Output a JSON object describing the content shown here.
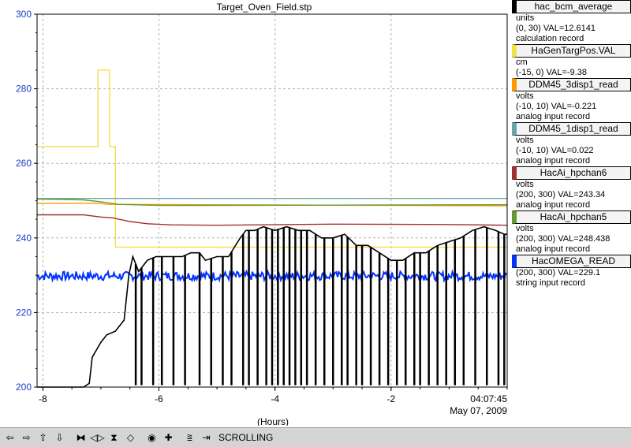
{
  "chart_data": {
    "type": "line",
    "title": "Target_Oven_Field.stp",
    "xlabel": "(Hours)",
    "ylabel": "",
    "xlim": [
      -8.1,
      0
    ],
    "ylim": [
      200,
      300
    ],
    "x_ticks": [
      -8,
      -6,
      -4,
      -2
    ],
    "x_tick_labels": [
      "-8",
      "-6",
      "-4",
      "-2"
    ],
    "y_ticks": [
      200,
      220,
      240,
      260,
      280,
      300
    ],
    "y_tick_labels": [
      "200",
      "220",
      "240",
      "260",
      "280",
      "300"
    ],
    "grid": true,
    "time_label": "04:07:45",
    "date_label": "May 07, 2009",
    "series": [
      {
        "name": "hac_bcm_average",
        "color": "#000000",
        "points": [
          [
            -8.1,
            200
          ],
          [
            -7.3,
            200
          ],
          [
            -7.2,
            201
          ],
          [
            -7.15,
            208
          ],
          [
            -7.0,
            212
          ],
          [
            -6.9,
            214
          ],
          [
            -6.75,
            215
          ],
          [
            -6.6,
            218
          ],
          [
            -6.52,
            230
          ],
          [
            -6.45,
            235
          ],
          [
            -6.35,
            231
          ],
          [
            -6.2,
            234
          ],
          [
            -6.05,
            235
          ],
          [
            -5.8,
            235
          ],
          [
            -5.6,
            235
          ],
          [
            -5.45,
            236
          ],
          [
            -5.3,
            236
          ],
          [
            -5.2,
            234
          ],
          [
            -5.0,
            235
          ],
          [
            -4.8,
            235
          ],
          [
            -4.6,
            240
          ],
          [
            -4.5,
            242
          ],
          [
            -4.35,
            242
          ],
          [
            -4.2,
            243
          ],
          [
            -4.0,
            242
          ],
          [
            -3.8,
            243
          ],
          [
            -3.6,
            242
          ],
          [
            -3.4,
            242
          ],
          [
            -3.2,
            240
          ],
          [
            -3.0,
            240
          ],
          [
            -2.8,
            241
          ],
          [
            -2.6,
            238
          ],
          [
            -2.4,
            238
          ],
          [
            -2.2,
            236
          ],
          [
            -2.0,
            234
          ],
          [
            -1.8,
            234
          ],
          [
            -1.6,
            236
          ],
          [
            -1.4,
            236
          ],
          [
            -1.2,
            238
          ],
          [
            -1.0,
            239
          ],
          [
            -0.8,
            240
          ],
          [
            -0.6,
            242
          ],
          [
            -0.4,
            243
          ],
          [
            -0.2,
            242
          ],
          [
            -0.05,
            241
          ],
          [
            0,
            241
          ]
        ],
        "dropouts": [
          -6.4,
          -6.3,
          -6.1,
          -5.95,
          -5.75,
          -5.55,
          -5.3,
          -5.1,
          -4.9,
          -4.75,
          -4.55,
          -4.45,
          -4.3,
          -4.15,
          -4.05,
          -3.95,
          -3.85,
          -3.75,
          -3.65,
          -3.55,
          -3.45,
          -3.3,
          -3.15,
          -3.0,
          -2.85,
          -2.75,
          -2.6,
          -2.5,
          -2.35,
          -2.2,
          -2.05,
          -1.9,
          -1.75,
          -1.6,
          -1.5,
          -1.35,
          -1.2,
          -1.05,
          -0.9,
          -0.75,
          -0.55,
          -0.35,
          -0.15,
          -0.05
        ]
      },
      {
        "name": "HaGenTargPos.VAL",
        "color": "#f0e04a",
        "points": [
          [
            -8.1,
            264.5
          ],
          [
            -7.05,
            264.5
          ],
          [
            -7.05,
            285
          ],
          [
            -6.85,
            285
          ],
          [
            -6.85,
            264.5
          ],
          [
            -6.75,
            264.5
          ],
          [
            -6.75,
            237.5
          ],
          [
            0,
            237.5
          ]
        ]
      },
      {
        "name": "DDM45_3disp1_read",
        "color": "#ff9900",
        "points": [
          [
            -8.1,
            249.3
          ],
          [
            -7.0,
            249.3
          ],
          [
            -6.9,
            249
          ],
          [
            0,
            248.6
          ]
        ]
      },
      {
        "name": "DDM45_1disp1_read",
        "color": "#66a6a6",
        "points": [
          [
            -8.1,
            250.6
          ],
          [
            0,
            250.6
          ]
        ]
      },
      {
        "name": "HacAi_hpchan6",
        "color": "#a03030",
        "points": [
          [
            -8.1,
            246.2
          ],
          [
            -7.3,
            246.2
          ],
          [
            -7.0,
            245.6
          ],
          [
            -6.8,
            245.4
          ],
          [
            -6.5,
            244.4
          ],
          [
            -6.2,
            243.8
          ],
          [
            -5.8,
            243.5
          ],
          [
            -5.0,
            243.4
          ],
          [
            -3.0,
            243.7
          ],
          [
            -1.0,
            243.6
          ],
          [
            0,
            243.4
          ]
        ]
      },
      {
        "name": "HacAi_hpchan5",
        "color": "#669933",
        "points": [
          [
            -8.1,
            250.4
          ],
          [
            -7.3,
            250.2
          ],
          [
            -7.0,
            249.7
          ],
          [
            -6.7,
            249
          ],
          [
            -6.0,
            248.7
          ],
          [
            -3.0,
            248.8
          ],
          [
            0,
            248.9
          ]
        ]
      },
      {
        "name": "HacOMEGA_READ",
        "color": "#0033ff",
        "points": [
          [
            -8.1,
            229.8
          ],
          [
            0,
            229.8
          ]
        ],
        "noise": 1.2
      }
    ]
  },
  "legend": [
    {
      "name": "hac_bcm_average",
      "color": "#000000",
      "unit": "units",
      "range_val": "(0, 30) VAL=12.6141",
      "record": "calculation record"
    },
    {
      "name": "HaGenTargPos.VAL",
      "color": "#f0e04a",
      "unit": "cm",
      "range_val": "(-15, 0) VAL=-9.38",
      "record": ""
    },
    {
      "name": "DDM45_3disp1_read",
      "color": "#ff9900",
      "unit": "volts",
      "range_val": "(-10, 10) VAL=-0.221",
      "record": "analog input record"
    },
    {
      "name": "DDM45_1disp1_read",
      "color": "#66a6a6",
      "unit": "volts",
      "range_val": "(-10, 10) VAL=0.022",
      "record": "analog input record"
    },
    {
      "name": "HacAi_hpchan6",
      "color": "#a03030",
      "unit": "volts",
      "range_val": "(200, 300) VAL=243.34",
      "record": "analog input record"
    },
    {
      "name": "HacAi_hpchan5",
      "color": "#669933",
      "unit": "volts",
      "range_val": "(200, 300) VAL=248.438",
      "record": "analog input record"
    },
    {
      "name": "HacOMEGA_READ",
      "color": "#0033ff",
      "unit": "",
      "range_val": "(200, 300) VAL=229.1",
      "record": "string input record"
    }
  ],
  "toolbar": {
    "buttons": [
      {
        "name": "scroll-left-button",
        "glyph": "⇦"
      },
      {
        "name": "scroll-right-button",
        "glyph": "⇨"
      },
      {
        "name": "scroll-up-button",
        "glyph": "⇧"
      },
      {
        "name": "scroll-down-button",
        "glyph": "⇩"
      },
      {
        "name": "zoom-in-horizontal-button",
        "glyph": "⧓"
      },
      {
        "name": "zoom-out-horizontal-button",
        "glyph": "◁▷"
      },
      {
        "name": "zoom-in-vertical-button",
        "glyph": "⧗"
      },
      {
        "name": "zoom-out-vertical-button",
        "glyph": "◇"
      },
      {
        "name": "autoscale-button",
        "glyph": "◉"
      },
      {
        "name": "add-button",
        "glyph": "✚"
      },
      {
        "name": "stagger-button",
        "glyph": "⩰"
      },
      {
        "name": "scroll-mode-button",
        "glyph": "⇥"
      }
    ],
    "mode_label": "SCROLLING"
  }
}
